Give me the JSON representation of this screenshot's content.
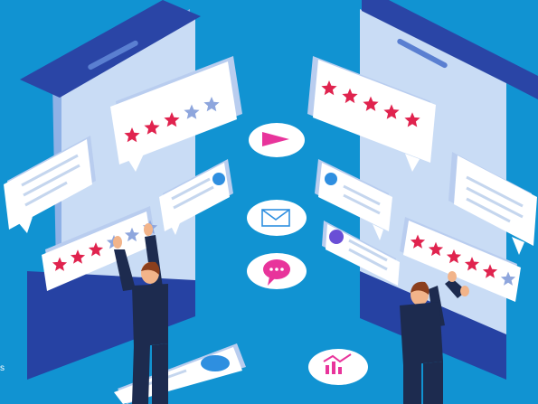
{
  "colors": {
    "background": "#1193d2",
    "phone_body": "#c9dcf5",
    "phone_side": "#8fb1e6",
    "phone_top": "#2a45a6",
    "phone_base": "#2642a3",
    "card": "#ffffff",
    "card_edge": "#b9cdef",
    "star_active": "#e0234e",
    "star_inactive": "#8ea6dd",
    "line_text": "#c5d6ee",
    "accent_blue": "#2e8fe0",
    "accent_pink": "#e8349b",
    "suit": "#1d2b4f",
    "hair": "#8b3f1d",
    "skin": "#f2b48a"
  },
  "ratings": [
    {
      "id": "left-top",
      "filled": 3,
      "total": 5
    },
    {
      "id": "left-bottom",
      "filled": 3,
      "total": 6
    },
    {
      "id": "right-top",
      "filled": 5,
      "total": 5
    },
    {
      "id": "right-bottom",
      "filled": 5,
      "total": 6
    }
  ],
  "icons": [
    "play-icon",
    "envelope-icon",
    "chat-bubble-icon",
    "chart-icon",
    "avatar-icon"
  ],
  "edge_text": "s"
}
